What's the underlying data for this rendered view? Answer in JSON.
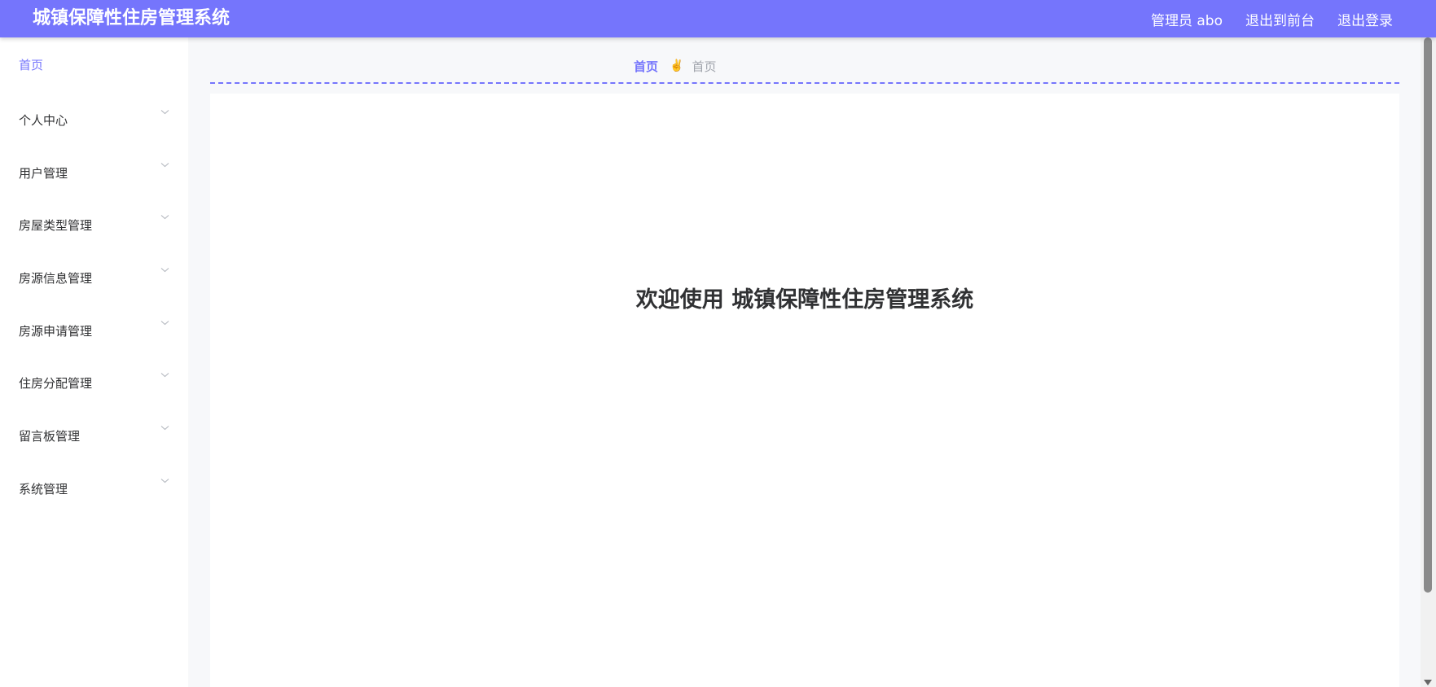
{
  "header": {
    "title": "城镇保障性住房管理系统",
    "nav": {
      "admin": "管理员 abo",
      "to_front": "退出到前台",
      "logout": "退出登录"
    },
    "colors": {
      "bar": "#7575fc",
      "text": "#ffffff"
    }
  },
  "sidebar": {
    "home": "首页",
    "items": [
      {
        "label": "个人中心",
        "icon": "chevron-down-icon"
      },
      {
        "label": "用户管理",
        "icon": "chevron-down-icon"
      },
      {
        "label": "房屋类型管理",
        "icon": "chevron-down-icon"
      },
      {
        "label": "房源信息管理",
        "icon": "chevron-down-icon"
      },
      {
        "label": "房源申请管理",
        "icon": "chevron-down-icon"
      },
      {
        "label": "住房分配管理",
        "icon": "chevron-down-icon"
      },
      {
        "label": "留言板管理",
        "icon": "chevron-down-icon"
      },
      {
        "label": "系统管理",
        "icon": "chevron-down-icon"
      }
    ]
  },
  "breadcrumb": {
    "home": "首页",
    "separator_icon": "victory-hand-icon",
    "current": "首页"
  },
  "main": {
    "welcome": "欢迎使用 城镇保障性住房管理系统"
  }
}
